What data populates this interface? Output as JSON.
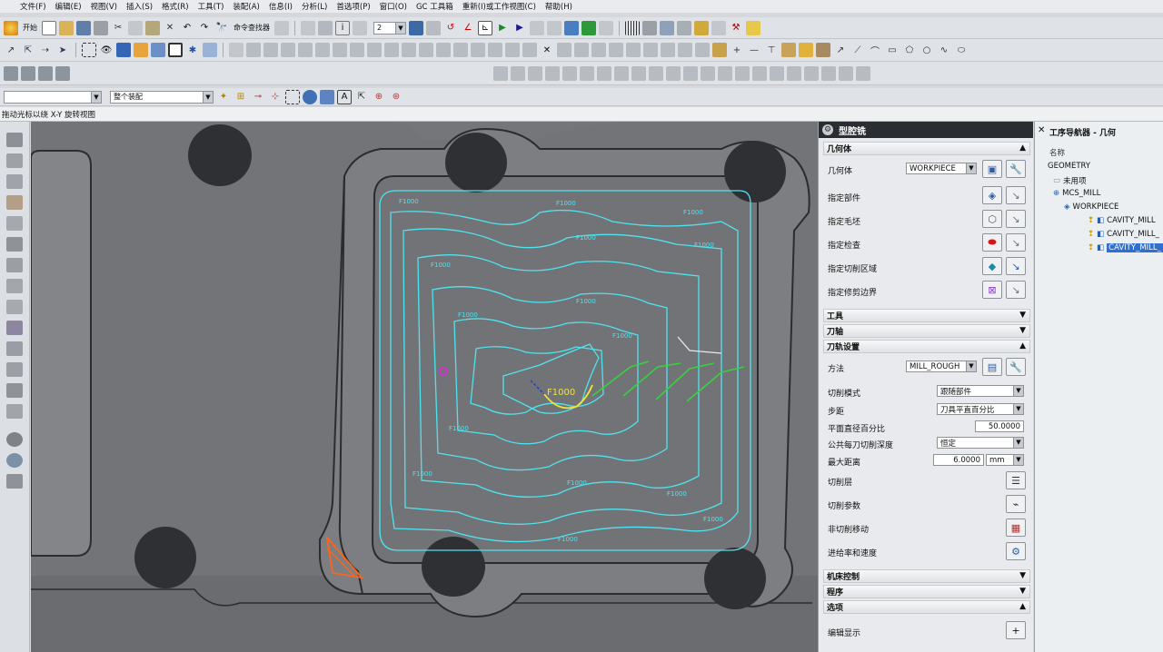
{
  "menu": [
    "文件(F)",
    "编辑(E)",
    "视图(V)",
    "插入(S)",
    "格式(R)",
    "工具(T)",
    "装配(A)",
    "信息(I)",
    "分析(L)",
    "首选项(P)",
    "窗口(O)",
    "GC 工具箱",
    "重新(I)或工作视图(C)",
    "帮助(H)"
  ],
  "toolbar1": {
    "start_label": "开始",
    "command_finder": "命令查找器",
    "layer_value": "2"
  },
  "toolbar4": {
    "combo1_value": "",
    "combo2_value": "整个装配"
  },
  "status_text": "拖动光标以绕 X-Y 旋转视图",
  "viewport": {
    "feed_label": "F1000"
  },
  "dialog": {
    "title": "型腔铣",
    "sections": {
      "geometry": "几何体",
      "tool": "工具",
      "axis": "刀轴",
      "path_settings": "刀轨设置",
      "machine_control": "机床控制",
      "program": "程序",
      "options": "选项"
    },
    "geometry_rows": {
      "geometry_label": "几何体",
      "geometry_value": "WORKPIECE",
      "specify_part": "指定部件",
      "specify_blank": "指定毛坯",
      "specify_check": "指定检查",
      "specify_cut_area": "指定切削区域",
      "specify_trim": "指定修剪边界"
    },
    "path_rows": {
      "method_label": "方法",
      "method_value": "MILL_ROUGH",
      "cut_pattern_label": "切削模式",
      "cut_pattern_value": "跟随部件",
      "stepover_label": "步距",
      "stepover_value": "刀具平直百分比",
      "percent_label": "平面直径百分比",
      "percent_value": "50.0000",
      "depth_mode_label": "公共每刀切削深度",
      "depth_mode_value": "恒定",
      "max_dist_label": "最大距离",
      "max_dist_value": "6.0000",
      "max_dist_unit": "mm",
      "cut_levels_label": "切削层",
      "cut_params_label": "切削参数",
      "non_cut_label": "非切削移动",
      "feeds_label": "进给率和速度"
    },
    "options_rows": {
      "edit_display_label": "编辑显示"
    }
  },
  "navigator": {
    "title": "工序导航器 - 几何",
    "column": "名称",
    "items": [
      "GEOMETRY",
      "未用项",
      "MCS_MILL",
      "WORKPIECE",
      "CAVITY_MILL",
      "CAVITY_MILL_",
      "CAVITY_MILL_"
    ]
  }
}
